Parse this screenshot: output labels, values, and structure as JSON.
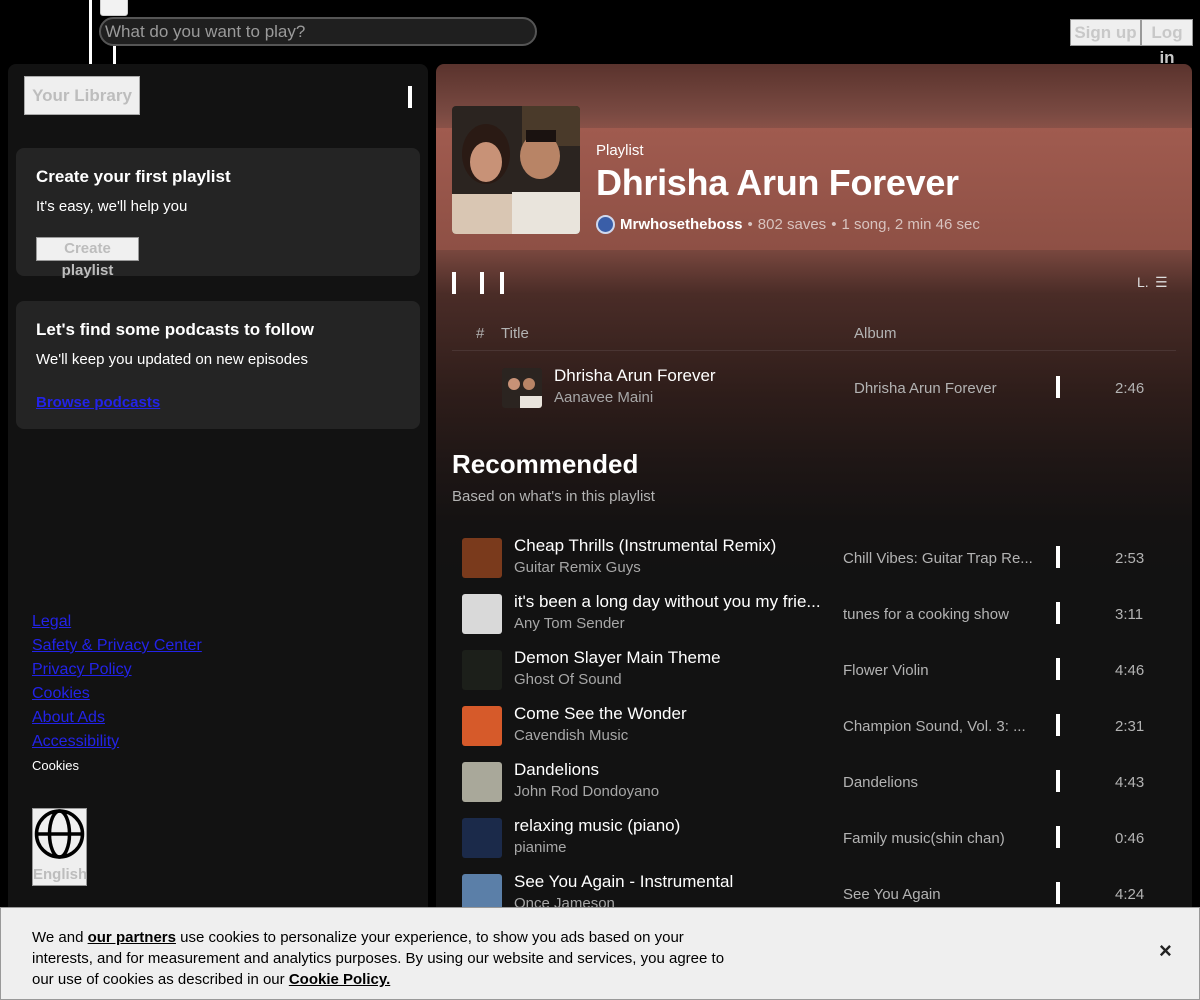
{
  "header": {
    "search_placeholder": "What do you want to play?",
    "signup_label": "Sign up",
    "login_label": "Log in"
  },
  "sidebar": {
    "library_label": "Your Library",
    "playlist_card": {
      "title": "Create your first playlist",
      "subtitle": "It's easy, we'll help you",
      "button": "Create playlist"
    },
    "podcast_card": {
      "title": "Let's find some podcasts to follow",
      "subtitle": "We'll keep you updated on new episodes",
      "link": "Browse podcasts"
    },
    "footer_links": [
      "Legal",
      "Safety & Privacy Center",
      "Privacy Policy",
      "Cookies",
      "About Ads",
      "Accessibility"
    ],
    "cookies_text": "Cookies",
    "language": "English"
  },
  "playlist": {
    "type": "Playlist",
    "title": "Dhrisha Arun Forever",
    "owner": "Mrwhosetheboss",
    "saves": "802 saves",
    "summary": "1 song, 2 min 46 sec",
    "list_label": "L.",
    "columns": {
      "number": "#",
      "title": "Title",
      "album": "Album"
    },
    "tracks": [
      {
        "title": "Dhrisha Arun Forever",
        "artist": "Aanavee Maini",
        "album": "Dhrisha Arun Forever",
        "duration": "2:46"
      }
    ]
  },
  "recommended": {
    "title": "Recommended",
    "subtitle": "Based on what's in this playlist",
    "tracks": [
      {
        "title": "Cheap Thrills (Instrumental Remix)",
        "artist": "Guitar Remix Guys",
        "album": "Chill Vibes: Guitar Trap Re...",
        "duration": "2:53",
        "thumb_color": "#7a3a1c"
      },
      {
        "title": "it's been a long day without you my frie...",
        "artist": "Any Tom Sender",
        "album": "tunes for a cooking show",
        "duration": "3:11",
        "thumb_color": "#d9d9d9"
      },
      {
        "title": "Demon Slayer Main Theme",
        "artist": "Ghost Of Sound",
        "album": "Flower Violin",
        "duration": "4:46",
        "thumb_color": "#1c1f1a"
      },
      {
        "title": "Come See the Wonder",
        "artist": "Cavendish Music",
        "album": "Champion Sound, Vol. 3: ...",
        "duration": "2:31",
        "thumb_color": "#d65a2a"
      },
      {
        "title": "Dandelions",
        "artist": "John Rod Dondoyano",
        "album": "Dandelions",
        "duration": "4:43",
        "thumb_color": "#a9a89a"
      },
      {
        "title": "relaxing music (piano)",
        "artist": "pianime",
        "album": "Family music(shin chan)",
        "duration": "0:46",
        "thumb_color": "#1b2a4a"
      },
      {
        "title": "See You Again - Instrumental",
        "artist": "Once Jameson",
        "album": "See You Again",
        "duration": "4:24",
        "thumb_color": "#5b7fa8"
      }
    ]
  },
  "cookie_banner": {
    "text_before": "We and",
    "partners_link": "our partners",
    "text_middle": "use cookies to personalize your experience, to show you ads based on your interests, and for measurement and analytics purposes. By using our website and services, you agree to our use of cookies as described in our",
    "policy_link": "Cookie Policy."
  }
}
